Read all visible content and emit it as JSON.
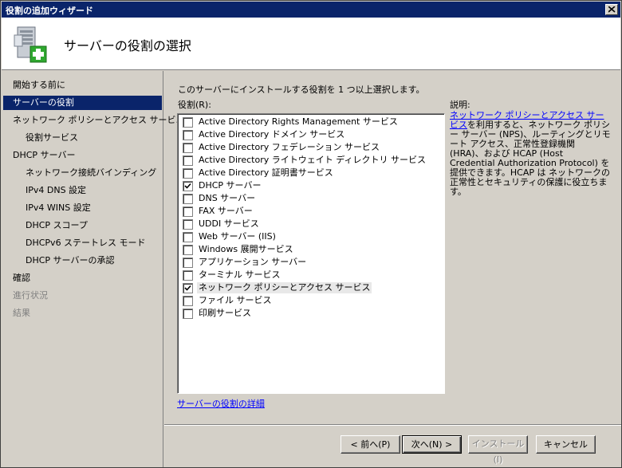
{
  "window": {
    "title": "役割の追加ウィザード"
  },
  "header": {
    "title": "サーバーの役割の選択"
  },
  "nav": {
    "items": [
      {
        "label": "開始する前に",
        "state": "normal",
        "indent": 0
      },
      {
        "label": "サーバーの役割",
        "state": "selected",
        "indent": 0
      },
      {
        "label": "ネットワーク ポリシーとアクセス サービ...",
        "state": "normal",
        "indent": 0
      },
      {
        "label": "役割サービス",
        "state": "normal",
        "indent": 1
      },
      {
        "label": "DHCP サーバー",
        "state": "normal",
        "indent": 0
      },
      {
        "label": "ネットワーク接続バインディング",
        "state": "normal",
        "indent": 1
      },
      {
        "label": "IPv4 DNS 設定",
        "state": "normal",
        "indent": 1
      },
      {
        "label": "IPv4 WINS 設定",
        "state": "normal",
        "indent": 1
      },
      {
        "label": "DHCP スコープ",
        "state": "normal",
        "indent": 1
      },
      {
        "label": "DHCPv6 ステートレス モード",
        "state": "normal",
        "indent": 1
      },
      {
        "label": "DHCP サーバーの承認",
        "state": "normal",
        "indent": 1
      },
      {
        "label": "確認",
        "state": "normal",
        "indent": 0
      },
      {
        "label": "進行状況",
        "state": "disabled",
        "indent": 0
      },
      {
        "label": "結果",
        "state": "disabled",
        "indent": 0
      }
    ]
  },
  "main": {
    "instruction": "このサーバーにインストールする役割を 1 つ以上選択します。",
    "roles_label": "役割(R):",
    "roles": [
      {
        "label": "Active Directory Rights Management サービス",
        "checked": false
      },
      {
        "label": "Active Directory ドメイン サービス",
        "checked": false
      },
      {
        "label": "Active Directory フェデレーション サービス",
        "checked": false
      },
      {
        "label": "Active Directory ライトウェイト ディレクトリ サービス",
        "checked": false
      },
      {
        "label": "Active Directory 証明書サービス",
        "checked": false
      },
      {
        "label": "DHCP サーバー",
        "checked": true
      },
      {
        "label": "DNS サーバー",
        "checked": false
      },
      {
        "label": "FAX サーバー",
        "checked": false
      },
      {
        "label": "UDDI サービス",
        "checked": false
      },
      {
        "label": "Web サーバー (IIS)",
        "checked": false
      },
      {
        "label": "Windows 展開サービス",
        "checked": false
      },
      {
        "label": "アプリケーション サーバー",
        "checked": false
      },
      {
        "label": "ターミナル サービス",
        "checked": false
      },
      {
        "label": "ネットワーク ポリシーとアクセス サービス",
        "checked": true,
        "highlight": true
      },
      {
        "label": "ファイル サービス",
        "checked": false
      },
      {
        "label": "印刷サービス",
        "checked": false
      }
    ],
    "description_heading": "説明:",
    "description_link": "ネットワーク ポリシーとアクセス サービス",
    "description_text": "を利用すると、ネットワーク ポリシー サーバー (NPS)、ルーティングとリモート アクセス、正常性登録機関 (HRA)、および HCAP (Host Credential Authorization Protocol) を提供できます。HCAP は ネットワークの正常性とセキュリティの保護に役立ちます。",
    "more_link": "サーバーの役割の詳細"
  },
  "buttons": {
    "back": "< 前へ(P)",
    "next": "次へ(N) >",
    "install": "インストール(I)",
    "cancel": "キャンセル"
  }
}
